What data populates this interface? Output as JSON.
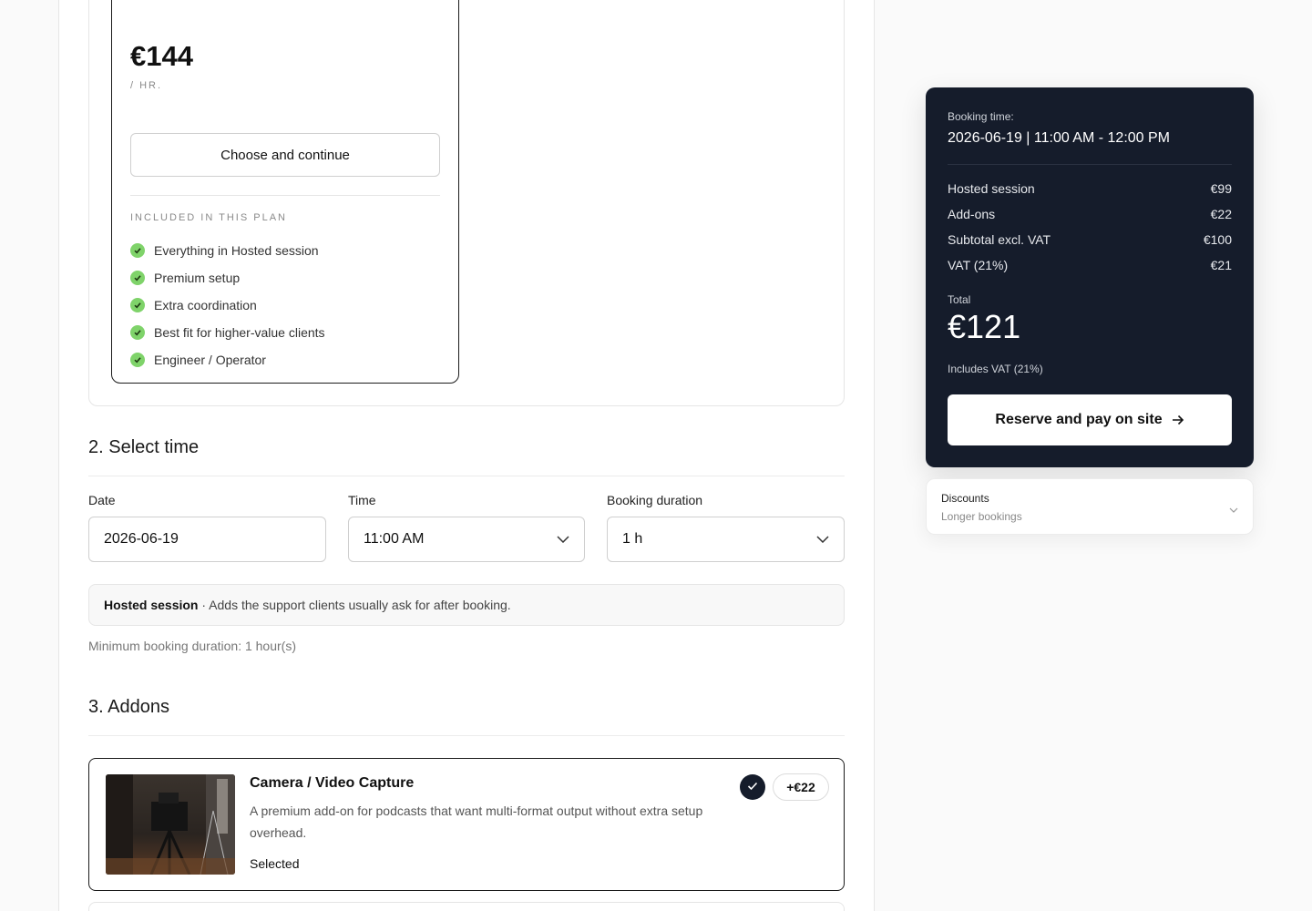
{
  "plan": {
    "price": "€144",
    "unit": "/ HR.",
    "choose_label": "Choose and continue",
    "included_label": "INCLUDED IN THIS PLAN",
    "features": [
      "Everything in Hosted session",
      "Premium setup",
      "Extra coordination",
      "Best fit for higher-value clients",
      "Engineer / Operator"
    ]
  },
  "select_time": {
    "title": "2. Select time",
    "date_label": "Date",
    "date_value": "2026-06-19",
    "time_label": "Time",
    "time_value": "11:00 AM",
    "duration_label": "Booking duration",
    "duration_value": "1 h",
    "banner_bold": "Hosted session",
    "banner_text": " · Adds the support clients usually ask for after booking.",
    "min_duration": "Minimum booking duration: 1 hour(s)"
  },
  "addons": {
    "title": "3. Addons",
    "items": [
      {
        "title": "Camera / Video Capture",
        "description": "A premium add-on for podcasts that want multi-format output without extra setup overhead.",
        "status": "Selected",
        "price": "+€22"
      }
    ]
  },
  "summary": {
    "booking_label": "Booking time:",
    "booking_time": "2026-06-19 | 11:00 AM - 12:00 PM",
    "rows": [
      {
        "label": "Hosted session",
        "value": "€99"
      },
      {
        "label": "Add-ons",
        "value": "€22"
      },
      {
        "label": "Subtotal excl. VAT",
        "value": "€100"
      },
      {
        "label": "VAT (21%)",
        "value": "€21"
      }
    ],
    "total_label": "Total",
    "total_value": "€121",
    "vat_note": "Includes VAT (21%)",
    "reserve_label": "Reserve and pay on site"
  },
  "discounts": {
    "title": "Discounts",
    "subtitle": "Longer bookings"
  },
  "colors": {
    "summary_bg": "#151c2b",
    "check_green": "#7fd36a"
  }
}
